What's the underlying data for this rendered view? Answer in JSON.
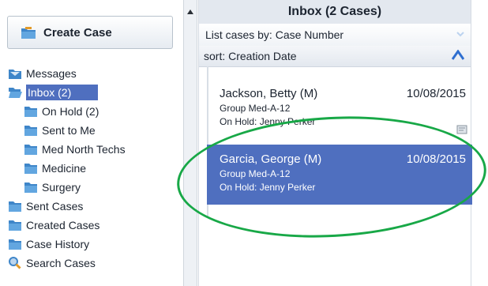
{
  "sidebar": {
    "create_case": "Create Case",
    "items": [
      {
        "label": "Messages",
        "icon": "messages-icon"
      },
      {
        "label": "Inbox (2)",
        "icon": "open-folder-icon"
      },
      {
        "label": "On Hold (2)",
        "icon": "folder-icon"
      },
      {
        "label": "Sent to Me",
        "icon": "folder-icon"
      },
      {
        "label": "Med North Techs",
        "icon": "folder-icon"
      },
      {
        "label": "Medicine",
        "icon": "folder-icon"
      },
      {
        "label": "Surgery",
        "icon": "folder-icon"
      },
      {
        "label": "Sent Cases",
        "icon": "folder-icon"
      },
      {
        "label": "Created Cases",
        "icon": "folder-icon"
      },
      {
        "label": "Case History",
        "icon": "folder-icon"
      },
      {
        "label": "Search Cases",
        "icon": "search-icon"
      }
    ]
  },
  "inbox": {
    "title": "Inbox (2 Cases)",
    "list_by": "List cases by: Case Number",
    "sort": "sort: Creation Date",
    "cases": [
      {
        "name": "Jackson, Betty (M)",
        "date": "10/08/2015",
        "group": "Group Med-A-12",
        "hold": "On Hold: Jenny Perker"
      },
      {
        "name": "Garcia, George (M)",
        "date": "10/08/2015",
        "group": "Group Med-A-12",
        "hold": "On Hold: Jenny Perker"
      }
    ]
  },
  "colors": {
    "accent": "#4f6fbf",
    "folder": "#3f86c9",
    "highlight_oval": "#18a847"
  }
}
